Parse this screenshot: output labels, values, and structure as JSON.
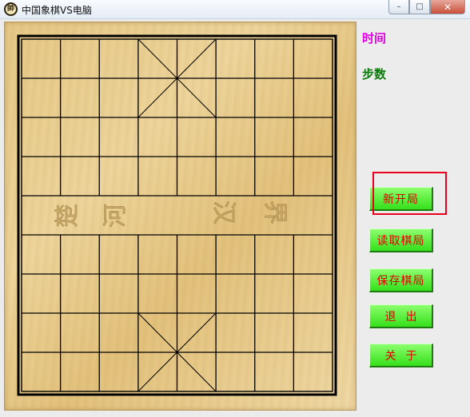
{
  "window": {
    "title": "中国象棋VS电脑",
    "icon_glyph": "帥",
    "controls": {
      "minimize": "–",
      "maximize": "□",
      "close": "✕"
    }
  },
  "board": {
    "river_left_text": [
      "楚",
      "河"
    ],
    "river_right_text": [
      "汉",
      "界"
    ]
  },
  "panel": {
    "time_label": "时间",
    "steps_label": "步数",
    "buttons": {
      "new_game": "新开局",
      "load_game": "读取棋局",
      "save_game": "保存棋局",
      "exit": "退出",
      "about": "关于"
    }
  },
  "colors": {
    "time_label": "#e000e0",
    "steps_label": "#0a7a0a",
    "button_bg": "#52ea33",
    "button_text": "#e00000",
    "highlight": "#e8001c"
  }
}
